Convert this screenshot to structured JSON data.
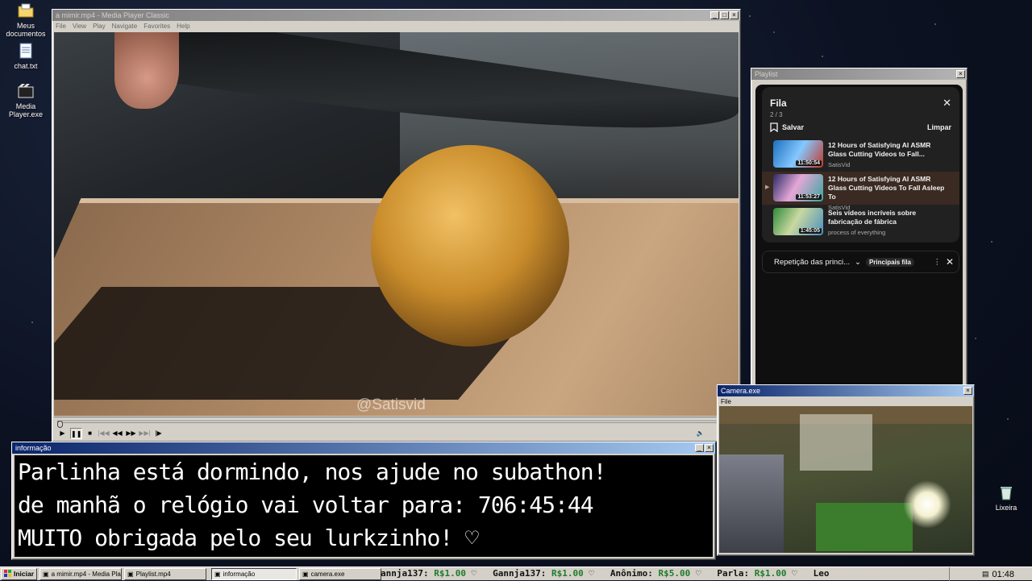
{
  "desktop": {
    "icons": [
      {
        "label": "Meus documentos",
        "icon": "folder-icon"
      },
      {
        "label": "chat.txt",
        "icon": "notepad-icon"
      },
      {
        "label": "Media Player.exe",
        "icon": "media-player-icon"
      },
      {
        "label": "Lixeira",
        "icon": "recycle-bin-icon"
      }
    ]
  },
  "player": {
    "title": "a mimir.mp4 - Media Player Classic",
    "menu": [
      "File",
      "View",
      "Play",
      "Navigate",
      "Favorites",
      "Help"
    ],
    "watermark": "@Satisvid",
    "progress": 0.003
  },
  "playlist_window": {
    "title": "Playlist",
    "queue": {
      "heading": "Fila",
      "count": "2 / 3",
      "save_label": "Salvar",
      "clear_label": "Limpar",
      "items": [
        {
          "title": "12 Hours of Satisfying AI ASMR Glass Cutting Videos to Fall...",
          "channel": "SatisVid",
          "duration": "11:50:54"
        },
        {
          "title": "12 Hours of Satisfying AI ASMR Glass Cutting Videos To Fall Asleep To",
          "channel": "SatisVid",
          "duration": "11:53:27"
        },
        {
          "title": "Seis vídeos incríveis sobre fabricação de fábrica",
          "channel": "process of everything",
          "duration": "1:45:05"
        }
      ]
    },
    "mix": {
      "label": "Repetição das princi...",
      "pill": "Principais fila"
    }
  },
  "info_window": {
    "title": "informação",
    "lines": [
      "Parlinha está dormindo, nos ajude no subathon!",
      "de manhã o relógio vai voltar para:  706:45:44",
      "MUITO obrigada pelo seu lurkzinho! ♡"
    ]
  },
  "camera_window": {
    "title": "Camera.exe",
    "menu": [
      "File"
    ]
  },
  "taskbar": {
    "start_label": "Iniciar",
    "tasks": [
      {
        "label": "a mimir.mp4 - Media Playe...",
        "active": false
      },
      {
        "label": "Playlist.mp4",
        "active": false
      },
      {
        "label": "informação",
        "active": true
      },
      {
        "label": "camera.exe",
        "active": false
      }
    ],
    "ticker": [
      {
        "name": "annja137:",
        "amount": "R$1.00"
      },
      {
        "name": "Gannja137:",
        "amount": "R$1.00"
      },
      {
        "name": "Anônimo:",
        "amount": "R$5.00"
      },
      {
        "name": "Parla:",
        "amount": "R$1.00"
      },
      {
        "name": "Leo",
        "amount": ""
      }
    ],
    "clock": "01:48"
  }
}
